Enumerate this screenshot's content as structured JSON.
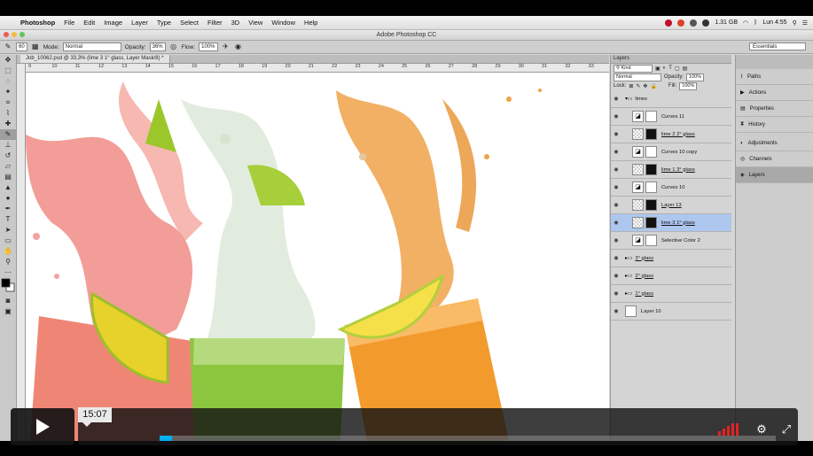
{
  "menubar": {
    "app": "Photoshop",
    "items": [
      "File",
      "Edit",
      "Image",
      "Layer",
      "Type",
      "Select",
      "Filter",
      "3D",
      "View",
      "Window",
      "Help"
    ],
    "memory": "1.31 GB",
    "clock": "Lun 4:55"
  },
  "window": {
    "title": "Adobe Photoshop CC"
  },
  "options": {
    "brush_size": "60",
    "mode_label": "Mode:",
    "mode_value": "Normal",
    "opacity_label": "Opacity:",
    "opacity_value": "36%",
    "flow_label": "Flow:",
    "flow_value": "100%",
    "workspace": "Essentials"
  },
  "document": {
    "tab": "Job_10062.psd @ 33,3% (lime 3 1° glass, Layer Mask/8) *",
    "ruler_ticks": [
      "9",
      "10",
      "11",
      "12",
      "13",
      "14",
      "15",
      "16",
      "17",
      "18",
      "19",
      "20",
      "21",
      "22",
      "23",
      "24",
      "25",
      "26",
      "27",
      "28",
      "29",
      "30",
      "31",
      "32",
      "33"
    ]
  },
  "layers_panel": {
    "title": "Layers",
    "kind_label": "Kind",
    "blend_mode": "Normal",
    "opacity_label": "Opacity:",
    "opacity_value": "100%",
    "lock_label": "Lock:",
    "fill_label": "Fill:",
    "fill_value": "100%",
    "layers": [
      {
        "name": "limes",
        "type": "group",
        "selected": false
      },
      {
        "name": "Curves 11",
        "type": "adjust",
        "selected": false
      },
      {
        "name": "lime 2 2° glass",
        "type": "mask",
        "selected": false
      },
      {
        "name": "Curves 10 copy",
        "type": "adjust",
        "selected": false
      },
      {
        "name": "lime 1 3° glass",
        "type": "mask",
        "selected": false
      },
      {
        "name": "Curves 10",
        "type": "adjust",
        "selected": false
      },
      {
        "name": "Layer 13",
        "type": "mask",
        "selected": false
      },
      {
        "name": "lime 3 1° glass",
        "type": "mask",
        "selected": true
      },
      {
        "name": "Selective Color 2",
        "type": "adjust",
        "selected": false
      },
      {
        "name": "3° glass",
        "type": "group",
        "selected": false
      },
      {
        "name": "2° glass",
        "type": "group",
        "selected": false
      },
      {
        "name": "1° glass",
        "type": "group",
        "selected": false
      },
      {
        "name": "Layer 10",
        "type": "plain",
        "selected": false
      }
    ]
  },
  "side_panels": [
    {
      "label": "Paths",
      "icon": "paths-icon",
      "active": false
    },
    {
      "label": "Actions",
      "icon": "actions-icon",
      "active": false
    },
    {
      "label": "Properties",
      "icon": "properties-icon",
      "active": false
    },
    {
      "label": "History",
      "icon": "history-icon",
      "active": false
    },
    {
      "label": "Adjustments",
      "icon": "adjustments-icon",
      "active": false
    },
    {
      "label": "Channels",
      "icon": "channels-icon",
      "active": false
    },
    {
      "label": "Layers",
      "icon": "layers-icon",
      "active": true
    }
  ],
  "player": {
    "time": "15:07",
    "progress": 0.02,
    "colors": {
      "accent": "#00adef",
      "volume": "#e52222"
    }
  }
}
